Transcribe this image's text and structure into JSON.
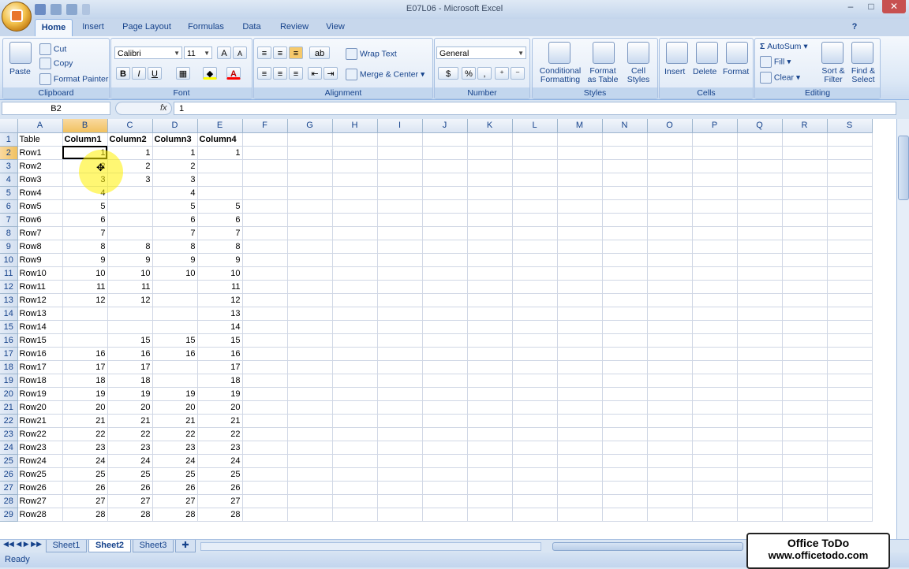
{
  "window": {
    "title": "E07L06 - Microsoft Excel",
    "controls": [
      "–",
      "□",
      "✕"
    ]
  },
  "tabs": [
    "Home",
    "Insert",
    "Page Layout",
    "Formulas",
    "Data",
    "Review",
    "View"
  ],
  "active_tab": "Home",
  "ribbon": {
    "clipboard": {
      "label": "Clipboard",
      "paste": "Paste",
      "cut": "Cut",
      "copy": "Copy",
      "format_painter": "Format Painter"
    },
    "font": {
      "label": "Font",
      "font_name": "Calibri",
      "font_size": "11",
      "bold": "B",
      "italic": "I",
      "underline": "U",
      "grow": "A",
      "shrink": "A"
    },
    "alignment": {
      "label": "Alignment",
      "wrap_text": "Wrap Text",
      "merge_center": "Merge & Center"
    },
    "number": {
      "label": "Number",
      "format": "General",
      "percent": "%",
      "comma": ","
    },
    "styles": {
      "label": "Styles",
      "conditional": "Conditional Formatting",
      "format_table": "Format as Table",
      "cell_styles": "Cell Styles"
    },
    "cells": {
      "label": "Cells",
      "insert": "Insert",
      "delete": "Delete",
      "format": "Format"
    },
    "editing": {
      "label": "Editing",
      "autosum": "AutoSum",
      "fill": "Fill",
      "clear": "Clear",
      "sort_filter": "Sort & Filter",
      "find_select": "Find & Select"
    }
  },
  "formula_bar": {
    "name_box": "B2",
    "fx": "fx",
    "value": "1"
  },
  "sheet": {
    "columns": [
      "A",
      "B",
      "C",
      "D",
      "E",
      "F",
      "G",
      "H",
      "I",
      "J",
      "K",
      "L",
      "M",
      "N",
      "O",
      "P",
      "Q",
      "R",
      "S"
    ],
    "selected_column": "B",
    "selected_row": 2,
    "rows": [
      [
        "1",
        "Table",
        "Column1",
        "Column2",
        "Column3",
        "Column4"
      ],
      [
        "2",
        "Row1",
        "1",
        "1",
        "1",
        "1"
      ],
      [
        "3",
        "Row2",
        "2",
        "2",
        "2",
        ""
      ],
      [
        "4",
        "Row3",
        "3",
        "3",
        "3",
        ""
      ],
      [
        "5",
        "Row4",
        "4",
        "",
        "4",
        ""
      ],
      [
        "6",
        "Row5",
        "5",
        "",
        "5",
        "5"
      ],
      [
        "7",
        "Row6",
        "6",
        "",
        "6",
        "6"
      ],
      [
        "8",
        "Row7",
        "7",
        "",
        "7",
        "7"
      ],
      [
        "9",
        "Row8",
        "8",
        "8",
        "8",
        "8"
      ],
      [
        "10",
        "Row9",
        "9",
        "9",
        "9",
        "9"
      ],
      [
        "11",
        "Row10",
        "10",
        "10",
        "10",
        "10"
      ],
      [
        "12",
        "Row11",
        "11",
        "11",
        "",
        "11"
      ],
      [
        "13",
        "Row12",
        "12",
        "12",
        "",
        "12"
      ],
      [
        "14",
        "Row13",
        "",
        "",
        "",
        "13"
      ],
      [
        "15",
        "Row14",
        "",
        "",
        "",
        "14"
      ],
      [
        "16",
        "Row15",
        "",
        "15",
        "15",
        "15"
      ],
      [
        "17",
        "Row16",
        "16",
        "16",
        "16",
        "16"
      ],
      [
        "18",
        "Row17",
        "17",
        "17",
        "",
        "17"
      ],
      [
        "19",
        "Row18",
        "18",
        "18",
        "",
        "18"
      ],
      [
        "20",
        "Row19",
        "19",
        "19",
        "19",
        "19"
      ],
      [
        "21",
        "Row20",
        "20",
        "20",
        "20",
        "20"
      ],
      [
        "22",
        "Row21",
        "21",
        "21",
        "21",
        "21"
      ],
      [
        "23",
        "Row22",
        "22",
        "22",
        "22",
        "22"
      ],
      [
        "24",
        "Row23",
        "23",
        "23",
        "23",
        "23"
      ],
      [
        "25",
        "Row24",
        "24",
        "24",
        "24",
        "24"
      ],
      [
        "26",
        "Row25",
        "25",
        "25",
        "25",
        "25"
      ],
      [
        "27",
        "Row26",
        "26",
        "26",
        "26",
        "26"
      ],
      [
        "28",
        "Row27",
        "27",
        "27",
        "27",
        "27"
      ],
      [
        "29",
        "Row28",
        "28",
        "28",
        "28",
        "28"
      ]
    ]
  },
  "sheet_tabs": [
    "Sheet1",
    "Sheet2",
    "Sheet3"
  ],
  "active_sheet": "Sheet2",
  "status": {
    "ready": "Ready"
  },
  "watermark": {
    "line1": "Office ToDo",
    "line2": "www.officetodo.com"
  }
}
